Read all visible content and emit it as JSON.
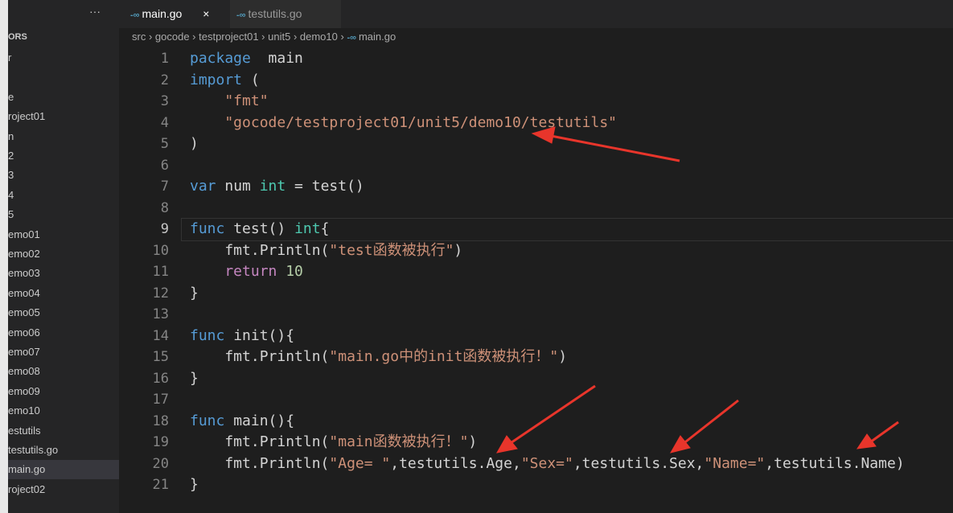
{
  "sidebar": {
    "header": "ORS",
    "more": "···",
    "items": [
      "r",
      "",
      "e",
      "roject01",
      "n",
      "2",
      "3",
      "4",
      "5",
      "emo01",
      "emo02",
      "emo03",
      "emo04",
      "emo05",
      "emo06",
      "emo07",
      "emo08",
      "emo09",
      "emo10",
      "estutils",
      "testutils.go",
      "main.go",
      "roject02"
    ],
    "selected": "main.go"
  },
  "tabs": [
    {
      "label": "main.go",
      "close": "×"
    },
    {
      "label": "testutils.go"
    }
  ],
  "breadcrumb": [
    "src",
    "gocode",
    "testproject01",
    "unit5",
    "demo10",
    "main.go"
  ],
  "current_line": 9,
  "code": [
    [
      [
        "k",
        "package"
      ],
      [
        "",
        "  main"
      ]
    ],
    [
      [
        "k",
        "import"
      ],
      [
        "",
        " ("
      ]
    ],
    [
      [
        "s",
        "    \"fmt\""
      ]
    ],
    [
      [
        "s",
        "    \"gocode/testproject01/unit5/demo10/testutils\""
      ]
    ],
    [
      [
        "",
        ")"
      ]
    ],
    [],
    [
      [
        "k",
        "var"
      ],
      [
        "",
        " num "
      ],
      [
        "t",
        "int"
      ],
      [
        "",
        " = test()"
      ]
    ],
    [],
    [
      [
        "k",
        "func"
      ],
      [
        "",
        " test() "
      ],
      [
        "t",
        "int"
      ],
      [
        "",
        "{"
      ]
    ],
    [
      [
        "",
        "    fmt.Println("
      ],
      [
        "s",
        "\"test函数被执行\""
      ],
      [
        "",
        ")"
      ]
    ],
    [
      [
        "r",
        "    return"
      ],
      [
        "",
        " "
      ],
      [
        "n",
        "10"
      ]
    ],
    [
      [
        "",
        "}"
      ]
    ],
    [],
    [
      [
        "k",
        "func"
      ],
      [
        "",
        " init(){"
      ]
    ],
    [
      [
        "",
        "    fmt.Println("
      ],
      [
        "s",
        "\"main.go中的init函数被执行！\""
      ],
      [
        "",
        ")"
      ]
    ],
    [
      [
        "",
        "}"
      ]
    ],
    [],
    [
      [
        "k",
        "func"
      ],
      [
        "",
        " main(){"
      ]
    ],
    [
      [
        "",
        "    fmt.Println("
      ],
      [
        "s",
        "\"main函数被执行！\""
      ],
      [
        "",
        ")"
      ]
    ],
    [
      [
        "",
        "    fmt.Println("
      ],
      [
        "s",
        "\"Age= \""
      ],
      [
        "",
        ",testutils.Age,"
      ],
      [
        "s",
        "\"Sex=\""
      ],
      [
        "",
        ",testutils.Sex,"
      ],
      [
        "s",
        "\"Name=\""
      ],
      [
        "",
        ",testutils.Name)"
      ]
    ],
    [
      [
        "",
        "}"
      ]
    ]
  ],
  "colors": {
    "annotation_arrow": "#e8352b",
    "keyword": "#569cd6",
    "string": "#ce9178",
    "type": "#4ec9b0"
  }
}
